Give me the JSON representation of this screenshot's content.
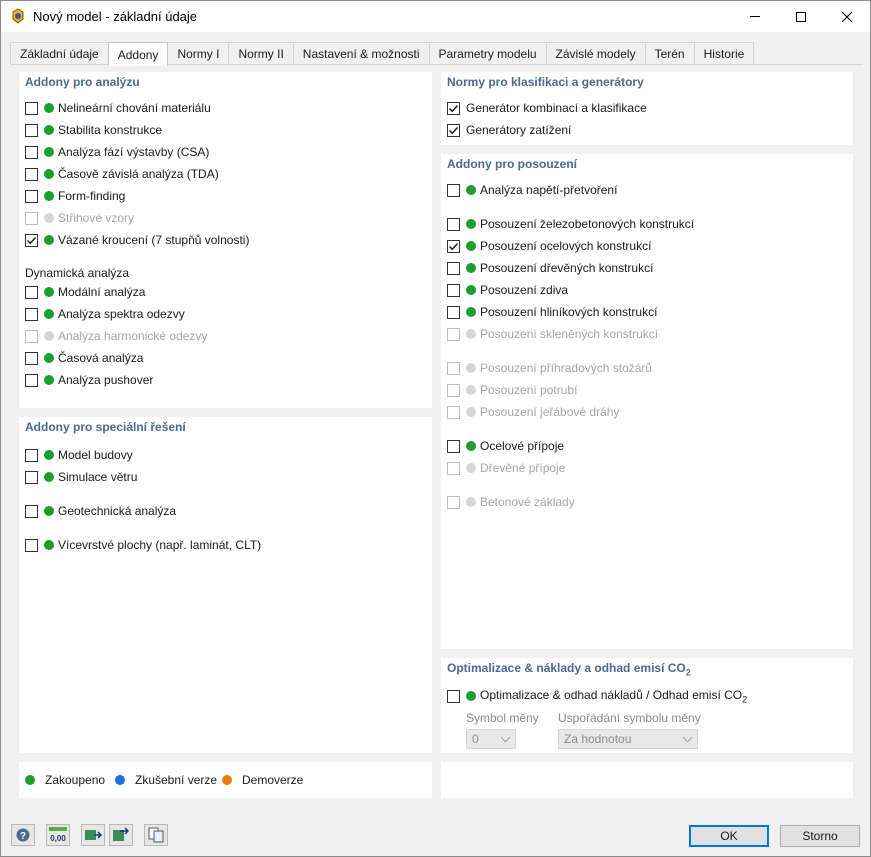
{
  "window": {
    "title": "Nový model - základní údaje"
  },
  "tabs": [
    "Základní údaje",
    "Addony",
    "Normy I",
    "Normy II",
    "Nastavení & možnosti",
    "Parametry modelu",
    "Závislé modely",
    "Terén",
    "Historie"
  ],
  "active_tab": "Addony",
  "analysis": {
    "title": "Addony pro analýzu",
    "items": [
      {
        "label": "Nelineární chování materiálu",
        "checked": false,
        "status": "purchased"
      },
      {
        "label": "Stabilita konstrukce",
        "checked": false,
        "status": "purchased"
      },
      {
        "label": "Analýza fází výstavby (CSA)",
        "checked": false,
        "status": "purchased"
      },
      {
        "label": "Časově závislá analýza (TDA)",
        "checked": false,
        "status": "purchased"
      },
      {
        "label": "Form-finding",
        "checked": false,
        "status": "purchased"
      },
      {
        "label": "Střihové vzory",
        "checked": false,
        "status": "disabled"
      },
      {
        "label": "Vázané kroucení (7 stupňů volnosti)",
        "checked": true,
        "status": "purchased"
      }
    ],
    "dynamic_title": "Dynamická analýza",
    "dynamic_items": [
      {
        "label": "Modální analýza",
        "checked": false,
        "status": "purchased"
      },
      {
        "label": "Analýza spektra odezvy",
        "checked": false,
        "status": "purchased"
      },
      {
        "label": "Analýza harmonické odezvy",
        "checked": false,
        "status": "disabled"
      },
      {
        "label": "Časová analýza",
        "checked": false,
        "status": "purchased"
      },
      {
        "label": "Analýza pushover",
        "checked": false,
        "status": "purchased"
      }
    ]
  },
  "special": {
    "title": "Addony pro speciální řešení",
    "items": [
      {
        "label": "Model budovy",
        "checked": false,
        "status": "purchased"
      },
      {
        "label": "Simulace větru",
        "checked": false,
        "status": "purchased"
      },
      {
        "label": "Geotechnická analýza",
        "checked": false,
        "status": "purchased"
      },
      {
        "label": "Vícevrstvé plochy (např. laminát, CLT)",
        "checked": false,
        "status": "purchased"
      }
    ]
  },
  "norms": {
    "title": "Normy pro klasifikaci a generátory",
    "items": [
      {
        "label": "Generátor kombinací a klasifikace",
        "checked": true
      },
      {
        "label": "Generátory zatížení",
        "checked": true
      }
    ]
  },
  "design": {
    "title": "Addony pro posouzení",
    "items": [
      {
        "label": "Analýza napětí-přetvoření",
        "checked": false,
        "status": "purchased"
      },
      {
        "label": "Posouzení železobetonových konstrukcí",
        "checked": false,
        "status": "purchased"
      },
      {
        "label": "Posouzení ocelových konstrukcí",
        "checked": true,
        "status": "purchased"
      },
      {
        "label": "Posouzení dřevěných konstrukcí",
        "checked": false,
        "status": "purchased"
      },
      {
        "label": "Posouzení zdiva",
        "checked": false,
        "status": "purchased"
      },
      {
        "label": "Posouzení hliníkových konstrukcí",
        "checked": false,
        "status": "purchased"
      },
      {
        "label": "Posouzení skleněných konstrukcí",
        "checked": false,
        "status": "disabled"
      },
      {
        "label": "Posouzení příhradových stožárů",
        "checked": false,
        "status": "disabled"
      },
      {
        "label": "Posouzení potrubí",
        "checked": false,
        "status": "disabled"
      },
      {
        "label": "Posouzení jeřábové dráhy",
        "checked": false,
        "status": "disabled"
      },
      {
        "label": "Ocelové přípoje",
        "checked": false,
        "status": "purchased"
      },
      {
        "label": "Dřevěné přípoje",
        "checked": false,
        "status": "disabled"
      },
      {
        "label": "Betonové základy",
        "checked": false,
        "status": "disabled"
      }
    ]
  },
  "optimization": {
    "title": "Optimalizace & náklady a odhad emisí CO",
    "title_sub": "2",
    "item_label": "Optimalizace & odhad nákladů / Odhad emisí CO",
    "item_sub": "2",
    "checked": false,
    "currency_symbol_label": "Symbol měny",
    "currency_symbol_value": "0",
    "symbol_arrangement_label": "Uspořádání symbolu měny",
    "symbol_arrangement_value": "Za hodnotou"
  },
  "legend": {
    "purchased": "Zakoupeno",
    "trial": "Zkušební verze",
    "demo": "Demoverze"
  },
  "colors": {
    "purchased": "#1a9e2c",
    "trial": "#1f6fe0",
    "demo": "#f07a12",
    "disabled": "#d6d6d6",
    "section_title": "#4a6a8e"
  },
  "toolbar": {
    "units_label": "0,00"
  },
  "buttons": {
    "ok": "OK",
    "cancel": "Storno"
  }
}
